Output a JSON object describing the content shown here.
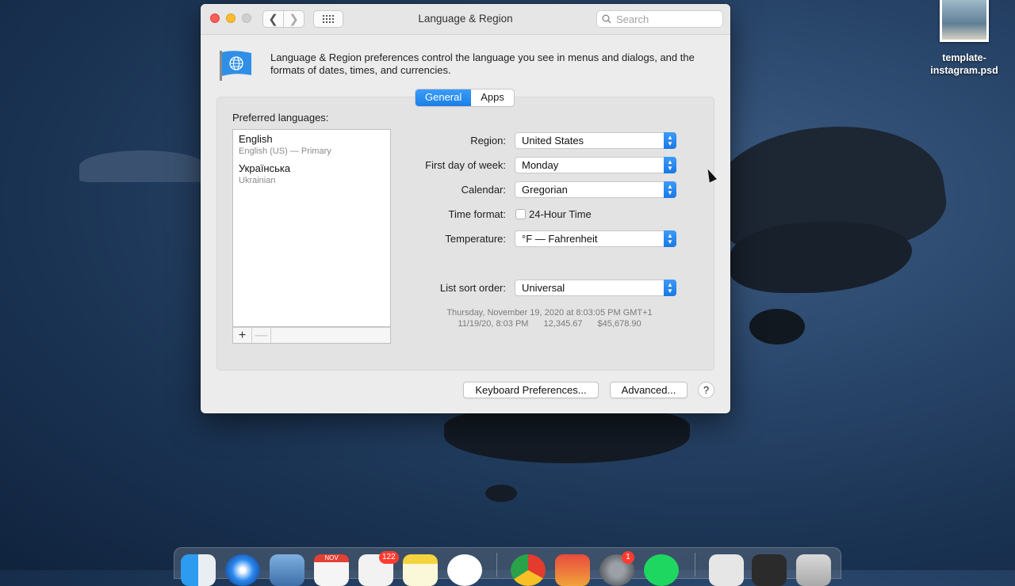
{
  "window": {
    "title": "Language & Region",
    "search_placeholder": "Search",
    "description": "Language & Region preferences control the language you see in menus and dialogs, and the formats of dates, times, and currencies."
  },
  "tabs": [
    {
      "label": "General",
      "active": true
    },
    {
      "label": "Apps",
      "active": false
    }
  ],
  "languages": {
    "label": "Preferred languages:",
    "items": [
      {
        "name": "English",
        "subtitle": "English (US) — Primary"
      },
      {
        "name": "Українська",
        "subtitle": "Ukrainian"
      }
    ],
    "add": "+",
    "remove": "—"
  },
  "settings": {
    "region": {
      "label": "Region:",
      "value": "United States"
    },
    "first_day": {
      "label": "First day of week:",
      "value": "Monday"
    },
    "calendar": {
      "label": "Calendar:",
      "value": "Gregorian"
    },
    "time_format": {
      "label": "Time format:",
      "checkbox_label": "24-Hour Time",
      "checked": false
    },
    "temperature": {
      "label": "Temperature:",
      "value": "°F — Fahrenheit"
    },
    "sort_order": {
      "label": "List sort order:",
      "value": "Universal"
    }
  },
  "sample": {
    "long_date": "Thursday, November 19, 2020 at 8:03:05 PM GMT+1",
    "short_date": "11/19/20, 8:03 PM",
    "number": "12,345.67",
    "currency": "$45,678.90"
  },
  "buttons": {
    "keyboard": "Keyboard Preferences...",
    "advanced": "Advanced...",
    "help": "?"
  },
  "desktop": {
    "file_label_1": "template-",
    "file_label_2": "instagram.psd"
  },
  "dock": {
    "calendar_month": "NOV",
    "reminders_badge": "122",
    "settings_badge": "1"
  }
}
